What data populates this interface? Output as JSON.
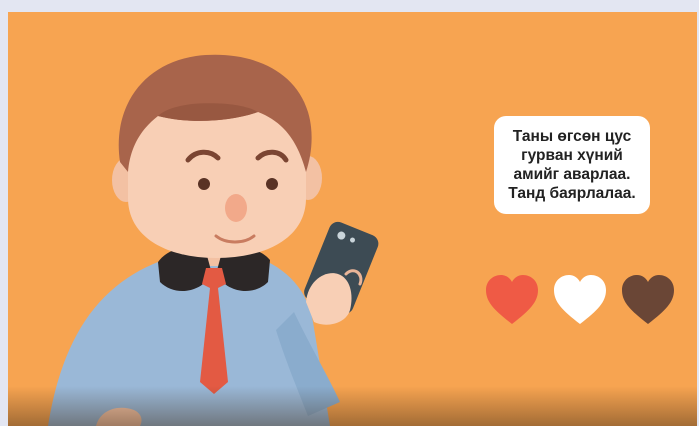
{
  "scene": {
    "message": "Таны өгсөн цус\nгурван хүний\nамийг аварлаа.\nТанд баярлалаа.",
    "colors": {
      "background": "#f7a451",
      "frame": "#e3e6f2",
      "bubble": "#ffffff",
      "shirt": "#9ab8d7",
      "tie": "#e35a43",
      "hair": "#a8644b",
      "skin": "#f8cfb5",
      "phone": "#3d4b54"
    },
    "hearts": [
      {
        "icon": "heart-icon",
        "color": "#ef5a45"
      },
      {
        "icon": "heart-icon",
        "color": "#ffffff"
      },
      {
        "icon": "heart-icon",
        "color": "#6a4636"
      }
    ]
  }
}
